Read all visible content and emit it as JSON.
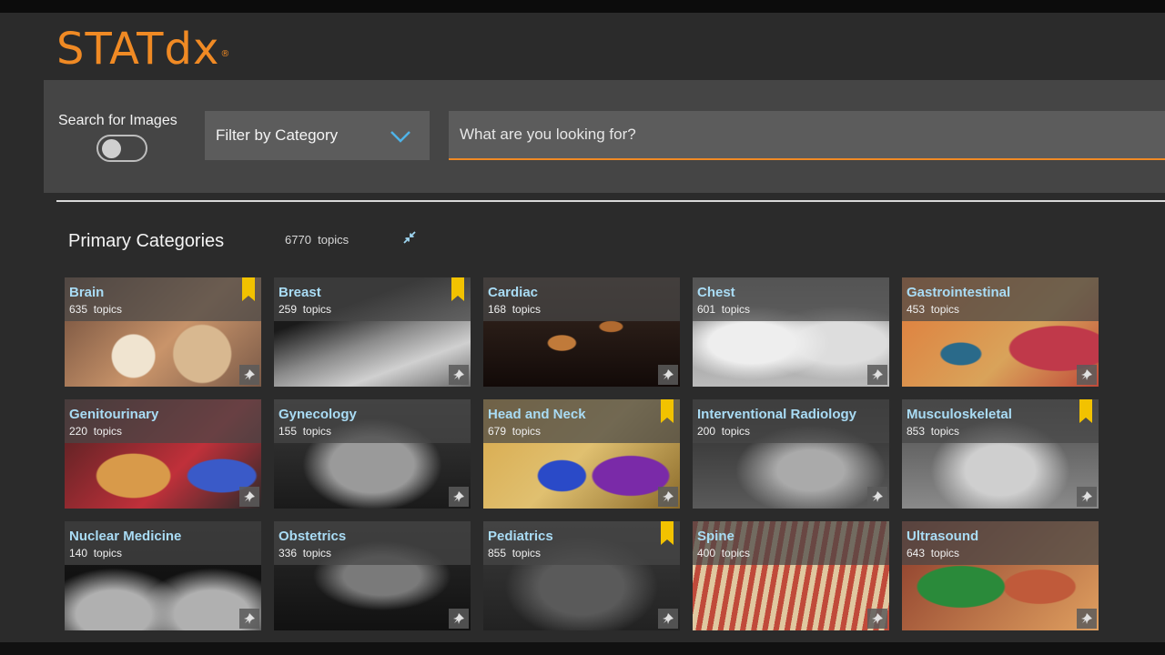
{
  "app": {
    "logo_text": "STATdx",
    "logo_mark": "®",
    "brand_color": "#f08a24",
    "link_color": "#a9dcf5",
    "bookmark_color": "#f2c200"
  },
  "search": {
    "toggle_label": "Search for Images",
    "toggle_on": false,
    "filter_label": "Filter by Category",
    "placeholder": "What are you looking for?"
  },
  "primary": {
    "title": "Primary Categories",
    "total_count": "6770",
    "total_unit": "topics"
  },
  "categories": [
    {
      "name": "Brain",
      "count": "635",
      "unit": "topics",
      "bookmarked": true
    },
    {
      "name": "Breast",
      "count": "259",
      "unit": "topics",
      "bookmarked": true
    },
    {
      "name": "Cardiac",
      "count": "168",
      "unit": "topics",
      "bookmarked": false
    },
    {
      "name": "Chest",
      "count": "601",
      "unit": "topics",
      "bookmarked": false
    },
    {
      "name": "Gastrointestinal",
      "count": "453",
      "unit": "topics",
      "bookmarked": false
    },
    {
      "name": "Genitourinary",
      "count": "220",
      "unit": "topics",
      "bookmarked": false
    },
    {
      "name": "Gynecology",
      "count": "155",
      "unit": "topics",
      "bookmarked": false
    },
    {
      "name": "Head and Neck",
      "count": "679",
      "unit": "topics",
      "bookmarked": true
    },
    {
      "name": "Interventional Radiology",
      "count": "200",
      "unit": "topics",
      "bookmarked": false
    },
    {
      "name": "Musculoskeletal",
      "count": "853",
      "unit": "topics",
      "bookmarked": true
    },
    {
      "name": "Nuclear Medicine",
      "count": "140",
      "unit": "topics",
      "bookmarked": false
    },
    {
      "name": "Obstetrics",
      "count": "336",
      "unit": "topics",
      "bookmarked": false
    },
    {
      "name": "Pediatrics",
      "count": "855",
      "unit": "topics",
      "bookmarked": true
    },
    {
      "name": "Spine",
      "count": "400",
      "unit": "topics",
      "bookmarked": false
    },
    {
      "name": "Ultrasound",
      "count": "643",
      "unit": "topics",
      "bookmarked": false
    }
  ]
}
